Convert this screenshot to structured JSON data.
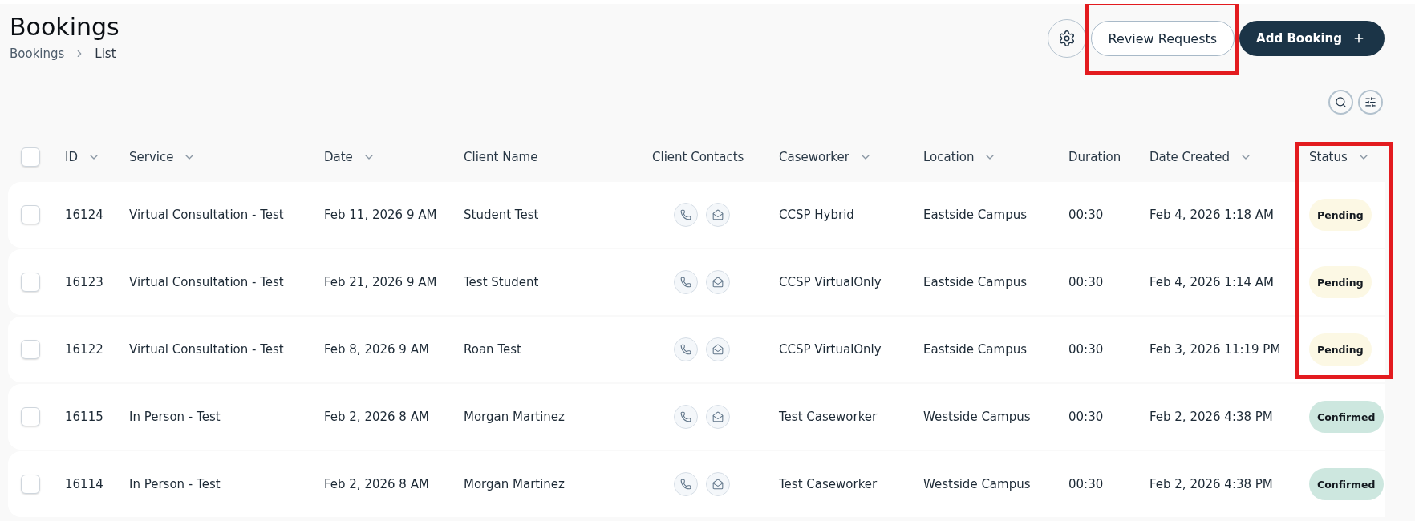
{
  "page": {
    "title": "Bookings",
    "breadcrumb": [
      {
        "label": "Bookings"
      },
      {
        "label": "List"
      }
    ]
  },
  "actions": [
    {
      "kind": "settings",
      "highlighted": false
    },
    {
      "kind": "secondary",
      "label": "Review Requests",
      "highlighted": true
    },
    {
      "kind": "primary",
      "label": "Add Booking",
      "highlighted": false
    }
  ],
  "toolbar": [
    {
      "kind": "search"
    },
    {
      "kind": "filter"
    }
  ],
  "table": {
    "select_all": {
      "checked": false
    },
    "columns": [
      {
        "label": "ID",
        "sortable": true,
        "highlighted": false
      },
      {
        "label": "Service",
        "sortable": true,
        "highlighted": false
      },
      {
        "label": "Date",
        "sortable": true,
        "highlighted": false
      },
      {
        "label": "Client Name",
        "sortable": false,
        "highlighted": false
      },
      {
        "label": "Client Contacts",
        "sortable": false,
        "highlighted": false
      },
      {
        "label": "Caseworker",
        "sortable": true,
        "highlighted": false
      },
      {
        "label": "Location",
        "sortable": true,
        "highlighted": false
      },
      {
        "label": "Duration",
        "sortable": false,
        "highlighted": false
      },
      {
        "label": "Date Created",
        "sortable": true,
        "highlighted": false
      },
      {
        "label": "Status",
        "sortable": true,
        "highlighted": true
      }
    ],
    "rows": [
      {
        "selected": false,
        "id": "16124",
        "service": "Virtual Consultation - Test",
        "date": "Feb 11, 2026 9 AM",
        "client_name": "Student Test",
        "caseworker": "CCSP Hybrid",
        "location": "Eastside Campus",
        "duration": "00:30",
        "date_created": "Feb 4, 2026 1:18 AM",
        "status": {
          "label": "Pending",
          "color": "#fcf8e4",
          "highlighted": true
        }
      },
      {
        "selected": false,
        "id": "16123",
        "service": "Virtual Consultation - Test",
        "date": "Feb 21, 2026 9 AM",
        "client_name": "Test Student",
        "caseworker": "CCSP VirtualOnly",
        "location": "Eastside Campus",
        "duration": "00:30",
        "date_created": "Feb 4, 2026 1:14 AM",
        "status": {
          "label": "Pending",
          "color": "#fcf8e4",
          "highlighted": true
        }
      },
      {
        "selected": false,
        "id": "16122",
        "service": "Virtual Consultation - Test",
        "date": "Feb 8, 2026 9 AM",
        "client_name": "Roan Test",
        "caseworker": "CCSP VirtualOnly",
        "location": "Eastside Campus",
        "duration": "00:30",
        "date_created": "Feb 3, 2026 11:19 PM",
        "status": {
          "label": "Pending",
          "color": "#fcf8e4",
          "highlighted": true
        }
      },
      {
        "selected": false,
        "id": "16115",
        "service": "In Person - Test",
        "date": "Feb 2, 2026 8 AM",
        "client_name": "Morgan Martinez",
        "caseworker": "Test Caseworker",
        "location": "Westside Campus",
        "duration": "00:30",
        "date_created": "Feb 2, 2026 4:38 PM",
        "status": {
          "label": "Confirmed",
          "color": "#cde7df",
          "highlighted": false
        }
      },
      {
        "selected": false,
        "id": "16114",
        "service": "In Person - Test",
        "date": "Feb 2, 2026 8 AM",
        "client_name": "Morgan Martinez",
        "caseworker": "Test Caseworker",
        "location": "Westside Campus",
        "duration": "00:30",
        "date_created": "Feb 2, 2026 4:38 PM",
        "status": {
          "label": "Confirmed",
          "color": "#cde7df",
          "highlighted": false
        }
      }
    ]
  }
}
